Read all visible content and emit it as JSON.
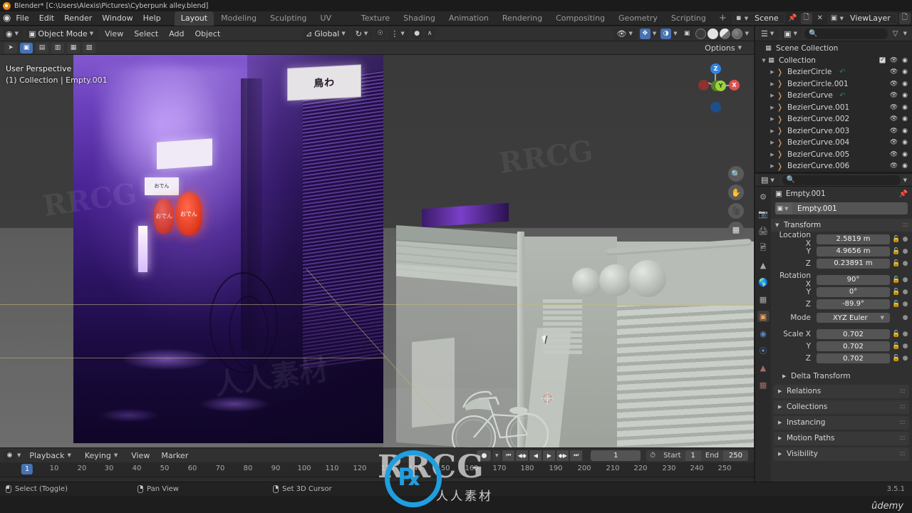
{
  "window": {
    "title": "Blender* [C:\\Users\\Alexis\\Pictures\\Cyberpunk alley.blend]",
    "version": "3.5.1"
  },
  "topbar": {
    "menus": [
      "File",
      "Edit",
      "Render",
      "Window",
      "Help"
    ],
    "workspaces": [
      {
        "label": "Layout",
        "active": true
      },
      {
        "label": "Modeling",
        "active": false
      },
      {
        "label": "Sculpting",
        "active": false
      },
      {
        "label": "UV Editing",
        "active": false
      },
      {
        "label": "Texture Paint",
        "active": false
      },
      {
        "label": "Shading",
        "active": false
      },
      {
        "label": "Animation",
        "active": false
      },
      {
        "label": "Rendering",
        "active": false
      },
      {
        "label": "Compositing",
        "active": false
      },
      {
        "label": "Geometry Nodes",
        "active": false
      },
      {
        "label": "Scripting",
        "active": false
      }
    ],
    "add_workspace": "+",
    "scene_name": "Scene",
    "viewlayer_name": "ViewLayer"
  },
  "viewport_header": {
    "mode": "Object Mode",
    "menus": [
      "View",
      "Select",
      "Add",
      "Object"
    ],
    "transform_orientation": "Global",
    "options_label": "Options"
  },
  "viewport": {
    "overlay_line1": "User Perspective",
    "overlay_line2": "(1) Collection | Empty.001",
    "gizmo_axes": [
      {
        "label": "Z",
        "name": "z-positive"
      },
      {
        "label": "X",
        "name": "x-positive"
      },
      {
        "label": "Y",
        "name": "y-positive"
      }
    ],
    "side_buttons": [
      "zoom-icon",
      "hand-icon",
      "camera-icon",
      "grid-icon"
    ],
    "reference_signs": {
      "top_sign": "鳥わ",
      "small_sign": "おでん",
      "lantern_1": "おでん",
      "lantern_2": "おでん"
    }
  },
  "outliner": {
    "filter_icon": "filter-icon",
    "search_placeholder": "",
    "rows": [
      {
        "label": "Scene Collection",
        "indent": 0,
        "icon": "scene-collection-icon",
        "expandable": false,
        "checkbox": false,
        "eye": false,
        "camera": false
      },
      {
        "label": "Collection",
        "indent": 1,
        "icon": "collection-icon",
        "expandable": true,
        "checkbox": true,
        "eye": true,
        "camera": true
      },
      {
        "label": "BezierCircle",
        "indent": 2,
        "icon": "curve-icon",
        "expandable": true,
        "checkbox": false,
        "eye": true,
        "camera": true,
        "animated": true
      },
      {
        "label": "BezierCircle.001",
        "indent": 2,
        "icon": "curve-icon",
        "expandable": true,
        "checkbox": false,
        "eye": true,
        "camera": true,
        "animated": false
      },
      {
        "label": "BezierCurve",
        "indent": 2,
        "icon": "curve-icon",
        "expandable": true,
        "checkbox": false,
        "eye": true,
        "camera": true,
        "animated": true
      },
      {
        "label": "BezierCurve.001",
        "indent": 2,
        "icon": "curve-icon",
        "expandable": true,
        "checkbox": false,
        "eye": true,
        "camera": true,
        "animated": false
      },
      {
        "label": "BezierCurve.002",
        "indent": 2,
        "icon": "curve-icon",
        "expandable": true,
        "checkbox": false,
        "eye": true,
        "camera": true,
        "animated": false
      },
      {
        "label": "BezierCurve.003",
        "indent": 2,
        "icon": "curve-icon",
        "expandable": true,
        "checkbox": false,
        "eye": true,
        "camera": true,
        "animated": false
      },
      {
        "label": "BezierCurve.004",
        "indent": 2,
        "icon": "curve-icon",
        "expandable": true,
        "checkbox": false,
        "eye": true,
        "camera": true,
        "animated": false
      },
      {
        "label": "BezierCurve.005",
        "indent": 2,
        "icon": "curve-icon",
        "expandable": true,
        "checkbox": false,
        "eye": true,
        "camera": true,
        "animated": false
      },
      {
        "label": "BezierCurve.006",
        "indent": 2,
        "icon": "curve-icon",
        "expandable": true,
        "checkbox": false,
        "eye": true,
        "camera": true,
        "animated": false
      }
    ]
  },
  "properties": {
    "search_placeholder": "",
    "breadcrumb_object": "Empty.001",
    "id_name": "Empty.001",
    "panel_transform": "Transform",
    "location": {
      "label_x": "Location X",
      "x": "2.5819 m",
      "label_y": "Y",
      "y": "4.9656 m",
      "label_z": "Z",
      "z": "0.23891 m"
    },
    "rotation": {
      "label_x": "Rotation X",
      "x": "90°",
      "label_y": "Y",
      "y": "0°",
      "label_z": "Z",
      "z": "-89.9°"
    },
    "mode_label": "Mode",
    "mode_value": "XYZ Euler",
    "scale": {
      "label_x": "Scale X",
      "x": "0.702",
      "label_y": "Y",
      "y": "0.702",
      "label_z": "Z",
      "z": "0.702"
    },
    "delta_transform": "Delta Transform",
    "closed_panels": [
      "Relations",
      "Collections",
      "Instancing",
      "Motion Paths",
      "Visibility"
    ],
    "tabs": [
      {
        "name": "tool",
        "icon": "tool-icon",
        "active": false
      },
      {
        "name": "render",
        "icon": "camera-back-icon",
        "active": false
      },
      {
        "name": "output",
        "icon": "printer-icon",
        "active": false
      },
      {
        "name": "view-layer",
        "icon": "images-icon",
        "active": false
      },
      {
        "name": "scene",
        "icon": "scene-cone-icon",
        "active": false
      },
      {
        "name": "world",
        "icon": "world-icon",
        "active": false
      },
      {
        "name": "collection",
        "icon": "collection-box-icon",
        "active": false
      },
      {
        "name": "object",
        "icon": "object-square-icon",
        "active": true
      },
      {
        "name": "constraints",
        "icon": "constraint-icon",
        "active": false
      },
      {
        "name": "physics",
        "icon": "physics-orbit-icon",
        "active": false
      },
      {
        "name": "object-data",
        "icon": "object-data-icon",
        "active": false
      },
      {
        "name": "texture",
        "icon": "checker-icon",
        "active": false
      }
    ]
  },
  "timeline": {
    "menus": [
      "Playback",
      "Keying",
      "View",
      "Marker"
    ],
    "current_frame": "1",
    "start_label": "Start",
    "start_value": "1",
    "end_label": "End",
    "end_value": "250",
    "playhead_frame": "1",
    "ticks": [
      "10",
      "20",
      "30",
      "40",
      "50",
      "60",
      "70",
      "80",
      "90",
      "100",
      "110",
      "120",
      "130",
      "140",
      "150",
      "160",
      "170",
      "180",
      "190",
      "200",
      "210",
      "220",
      "230",
      "240",
      "250"
    ]
  },
  "statusbar": {
    "items": [
      {
        "mouse": "left",
        "label": "Select (Toggle)"
      },
      {
        "mouse": "middle",
        "label": "Pan View"
      },
      {
        "mouse": "right",
        "label": "Set 3D Cursor"
      }
    ],
    "version": "3.5.1"
  },
  "watermarks": {
    "brand": "RRCG",
    "brand_cn": "人人素材",
    "udemy": "ûdemy"
  },
  "colors": {
    "accent_blue": "#4772b3",
    "axis_x": "#e0524e",
    "axis_y": "#9cd240",
    "axis_z": "#2f83e3",
    "curve_orange": "#d69a5c",
    "active_tab_orange": "#e8a35a",
    "bg_dark": "#1d1d1d",
    "panel_bg": "#303030",
    "field_bg": "#545454"
  }
}
